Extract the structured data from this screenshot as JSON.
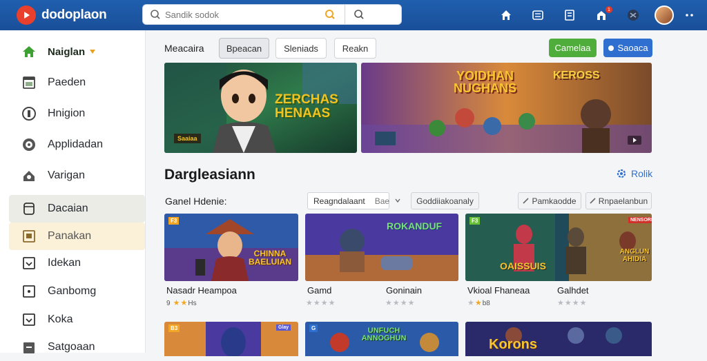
{
  "app": {
    "name": "dodoplaon"
  },
  "search": {
    "placeholder": "Sandik sodok"
  },
  "colors": {
    "topbar": "#1f5fae",
    "accent_green": "#4fae3b",
    "accent_blue": "#2f6fd0",
    "logo_red": "#e8402d",
    "star": "#f2a623"
  },
  "topbar_icons": [
    "home-icon",
    "library-icon",
    "news-icon",
    "notifications-icon",
    "controller-icon"
  ],
  "sidebar": {
    "items": [
      {
        "label": "Naiglan",
        "icon": "home-icon"
      },
      {
        "label": "Paeden",
        "icon": "calendar-icon"
      },
      {
        "label": "Hnigion",
        "icon": "shield-icon"
      },
      {
        "label": "Applidadan",
        "icon": "disc-icon"
      },
      {
        "label": "Varigan",
        "icon": "users-icon"
      },
      {
        "label": "Dacaian",
        "icon": "folder-icon"
      },
      {
        "label": "Panakan",
        "icon": "book-icon"
      },
      {
        "label": "Idekan",
        "icon": "check-box-icon"
      },
      {
        "label": "Ganbomg",
        "icon": "square-dot-icon"
      },
      {
        "label": "Koka",
        "icon": "check-box-icon"
      },
      {
        "label": "Satgoaan",
        "icon": "archive-icon"
      }
    ]
  },
  "toolbar": {
    "label": "Meacaira",
    "tabs": [
      "Bpeacan",
      "Sleniads",
      "Reakn"
    ],
    "green_button": "Camelaa",
    "blue_button": "Saoaca"
  },
  "banners": [
    {
      "title_line1": "ZERCHAS",
      "title_line2": "HENAAS",
      "tag": "Saaiaa"
    },
    {
      "title_line1": "YOIDHAN",
      "title_line2": "NUGHANS",
      "tag": "KEROSS"
    }
  ],
  "section": {
    "title": "Dargleasiann",
    "more_link": "Rolik",
    "filter_label": "Ganel Hdenie:",
    "filter_select": "Reagndalaant",
    "filter_select_sub": "Bae",
    "filter_chip_1": "Goddiiakoanaly",
    "filter_chip_2": "Pamkaodde",
    "filter_chip_3": "Rnpaelanbun"
  },
  "cards": [
    {
      "title": "Nasadr Heampoa",
      "rating": 2,
      "count": "Hs",
      "prefix": "9",
      "badge": "F3",
      "art": "CHINNA BAELUIAN"
    },
    {
      "title": "Gamd",
      "rating": 0,
      "count": "",
      "prefix": "",
      "badge": "",
      "art": "ROKANDUF"
    },
    {
      "title": "Goninain",
      "rating": 0,
      "count": "",
      "prefix": "",
      "badge": "",
      "art": ""
    },
    {
      "title": "Vkioal Fhaneaa",
      "rating": 2,
      "count": "b8",
      "prefix": "",
      "badge": "F3",
      "art": "OAISSUIS"
    },
    {
      "title": "Galhdet",
      "rating": 0,
      "count": "",
      "prefix": "",
      "badge": "NENSORE",
      "art": "ANGLUN AHIDIA"
    }
  ],
  "row2": [
    {
      "badge": "B3",
      "badge2": "Glay"
    },
    {
      "badge": "G",
      "art": "UNFUCH ANNOGHUN"
    },
    {
      "art": "Korons"
    }
  ]
}
